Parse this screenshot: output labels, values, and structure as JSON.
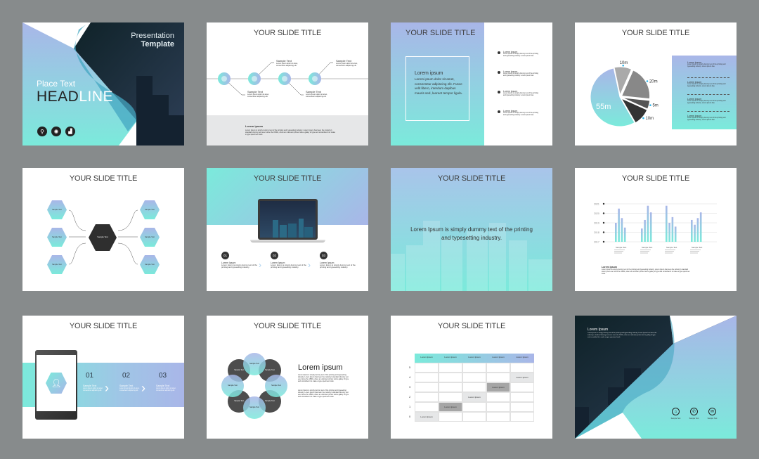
{
  "colors": {
    "background": "#878b8c",
    "teal": "#7beadb",
    "lavender": "#a9b6e8",
    "dark": "#1d2b36",
    "grey": "#e6e7e8"
  },
  "common": {
    "slide_title": "YOUR SLIDE TITLE",
    "sample_text": "Sample Text",
    "sample_body": "Lorem ipsum dolor sit amet, consectetur adipiscing elit.",
    "lorem_title": "Lorem ipsum",
    "lorem_body": "Lorem Ipsum is simply dummy text of the printing and typesetting industry. Lorem Ipsum has been the industry's standard dummy text ever since the 1500s, when an unknown printer took a galley of type and scrambled it to make a type specimen book."
  },
  "slide1": {
    "presentation": "Presentation",
    "template": "Template",
    "place_text": "Place Text",
    "headline_bold": "HEAD",
    "headline_light": "LINE",
    "icons": [
      "search-icon",
      "lightbulb-icon",
      "chart-icon"
    ]
  },
  "slide3": {
    "box_title": "Lorem ipsum",
    "box_body": "Lorem ipsum dolor sit amet, consectetur adipiscing elit. Fusce velit libero, interdum dapibus mauris sed, laoreet tempor ligula.",
    "bullet_title": "Lorem ipsum",
    "bullet_body": "Lorem Ipsum is simply dummy text of the printing and typesetting industry. Lorem Ipsum has."
  },
  "slide6": {
    "steps": [
      {
        "num": "01",
        "title": "Lorem Ipsum",
        "body": "Lorem Ipsum is simply dummy text of the printing and typesetting industry."
      },
      {
        "num": "02",
        "title": "Lorem Ipsum",
        "body": "Lorem Ipsum is simply dummy text of the printing and typesetting industry."
      },
      {
        "num": "03",
        "title": "Lorem Ipsum",
        "body": "Lorem Ipsum is simply dummy text of the printing and typesetting industry."
      }
    ]
  },
  "slide7": {
    "headline": "Lorem Ipsum is simply dummy text of the printing and typesetting industry."
  },
  "slide9": {
    "steps": [
      "01",
      "02",
      "03"
    ],
    "icon": "user-icon"
  },
  "slide10": {
    "heading": "Lorem ipsum"
  },
  "slide11": {
    "headers": [
      "Lorem Ipsum",
      "Lorem Ipsum",
      "Lorem Ipsum",
      "Lorem Ipsum",
      "Lorem Ipsum"
    ],
    "rows": [
      "5",
      "4",
      "3",
      "2",
      "1",
      "0"
    ],
    "cell_text": "Lorem Ipsum"
  },
  "slide12": {
    "title": "Lorem Ipsum",
    "icons": [
      "home-icon",
      "phone-icon",
      "message-icon"
    ]
  },
  "chart_data": [
    {
      "type": "pie",
      "slices": [
        {
          "label": "10m",
          "value": 10
        },
        {
          "label": "20m",
          "value": 20
        },
        {
          "label": "5m",
          "value": 5
        },
        {
          "label": "10m",
          "value": 10
        },
        {
          "label": "55m",
          "value": 55
        }
      ]
    },
    {
      "type": "bar",
      "y_ticks": [
        "2017",
        "2018",
        "2019",
        "2020",
        "2021"
      ],
      "ylim": [
        2017,
        2021
      ],
      "grid": true,
      "categories": [
        "Sample Text",
        "Sample Text",
        "Sample Text",
        "Sample Text"
      ],
      "groups": [
        [
          2019.0,
          2020.5,
          2019.5,
          2018.5
        ],
        [
          2018.4,
          2019.3,
          2020.8,
          2020.1
        ],
        [
          2020.8,
          2019.0,
          2019.6,
          2018.6
        ],
        [
          2019.3,
          2018.8,
          2019.5,
          2020.1
        ]
      ]
    }
  ]
}
